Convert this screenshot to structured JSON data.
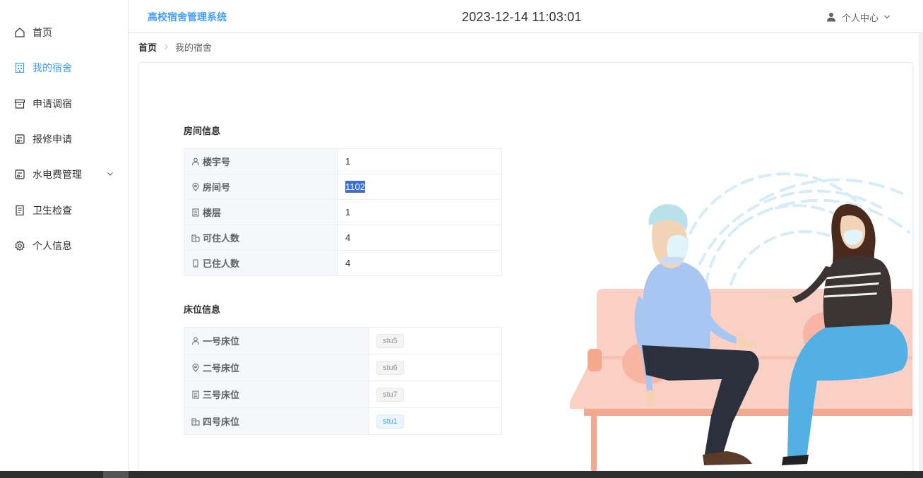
{
  "header": {
    "app_title": "高校宿舍管理系统",
    "clock": "2023-12-14 11:03:01",
    "user_menu_label": "个人中心"
  },
  "sidebar": {
    "items": [
      {
        "label": "首页",
        "icon": "home-icon",
        "active": false
      },
      {
        "label": "我的宿舍",
        "icon": "building-icon",
        "active": true
      },
      {
        "label": "申请调宿",
        "icon": "box-icon",
        "active": false
      },
      {
        "label": "报修申请",
        "icon": "repair-icon",
        "active": false
      },
      {
        "label": "水电费管理",
        "icon": "utility-icon",
        "active": false,
        "has_submenu": true
      },
      {
        "label": "卫生检查",
        "icon": "document-icon",
        "active": false
      },
      {
        "label": "个人信息",
        "icon": "gear-icon",
        "active": false
      }
    ]
  },
  "breadcrumb": {
    "home": "首页",
    "current": "我的宿舍"
  },
  "room_info": {
    "title": "房间信息",
    "rows": [
      {
        "label": "楼宇号",
        "icon": "user-icon",
        "value": "1"
      },
      {
        "label": "房间号",
        "icon": "location-icon",
        "value": "1102"
      },
      {
        "label": "楼层",
        "icon": "tickets-icon",
        "value": "1"
      },
      {
        "label": "可住人数",
        "icon": "office-icon",
        "value": "4"
      },
      {
        "label": "已住人数",
        "icon": "mobile-icon",
        "value": "4"
      }
    ]
  },
  "bed_info": {
    "title": "床位信息",
    "rows": [
      {
        "label": "一号床位",
        "icon": "user-icon",
        "value": "stu5",
        "highlight": false
      },
      {
        "label": "二号床位",
        "icon": "location-icon",
        "value": "stu6",
        "highlight": false
      },
      {
        "label": "三号床位",
        "icon": "tickets-icon",
        "value": "stu7",
        "highlight": false
      },
      {
        "label": "四号床位",
        "icon": "office-icon",
        "value": "stu1",
        "highlight": true
      }
    ]
  },
  "colors": {
    "accent": "#409eff",
    "selection": "#3b6fd6",
    "table_key_bg": "#f5f7fa"
  }
}
